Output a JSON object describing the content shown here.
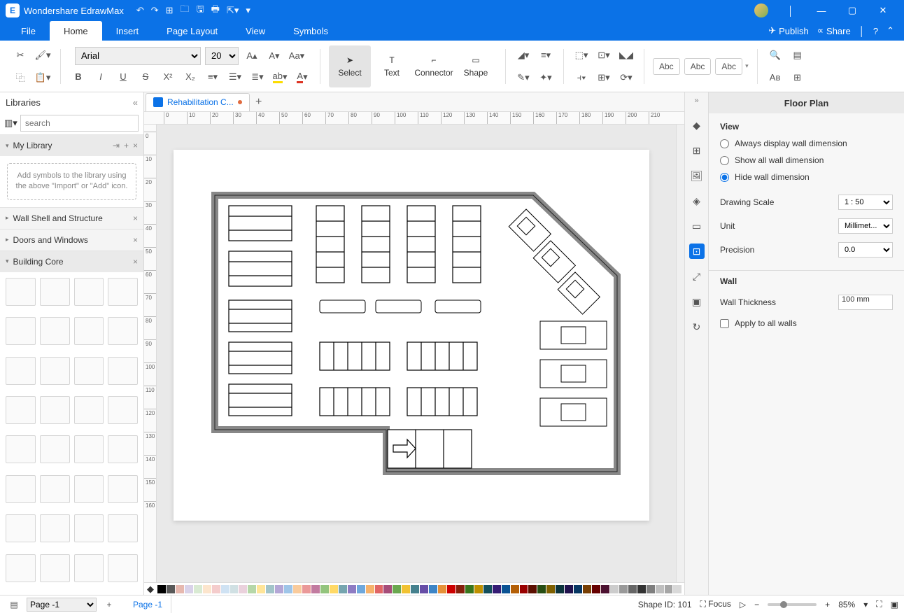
{
  "app": {
    "name": "Wondershare EdrawMax"
  },
  "menubar": {
    "tabs": [
      "File",
      "Home",
      "Insert",
      "Page Layout",
      "View",
      "Symbols"
    ],
    "active": "Home",
    "publish": "Publish",
    "share": "Share"
  },
  "ribbon": {
    "font": "Arial",
    "size": "20",
    "tools": {
      "select": "Select",
      "text": "Text",
      "connector": "Connector",
      "shape": "Shape"
    },
    "abc": "Abc"
  },
  "libraries": {
    "title": "Libraries",
    "search_ph": "search",
    "mylib": "My Library",
    "addmsg": "Add symbols to the library using the above \"Import\" or \"Add\" icon.",
    "sections": [
      "Wall Shell and Structure",
      "Doors and Windows",
      "Building Core"
    ]
  },
  "doc": {
    "tab": "Rehabilitation C..."
  },
  "ruler_h": [
    "0",
    "10",
    "20",
    "30",
    "40",
    "50",
    "60",
    "70",
    "80",
    "90",
    "100",
    "110",
    "120",
    "130",
    "140",
    "150",
    "160",
    "170",
    "180",
    "190",
    "200",
    "210"
  ],
  "ruler_v": [
    "0",
    "10",
    "20",
    "30",
    "40",
    "50",
    "60",
    "70",
    "80",
    "90",
    "100",
    "110",
    "120",
    "130",
    "140",
    "150",
    "160"
  ],
  "rightpanel": {
    "title": "Floor Plan",
    "view": "View",
    "radios": [
      "Always display wall dimension",
      "Show all wall dimension",
      "Hide wall dimension"
    ],
    "selected": 2,
    "scale_label": "Drawing Scale",
    "scale": "1 : 50",
    "unit_label": "Unit",
    "unit": "Millimet...",
    "precision_label": "Precision",
    "precision": "0.0",
    "wall": "Wall",
    "thickness_label": "Wall Thickness",
    "thickness": "100 mm",
    "apply": "Apply to all walls"
  },
  "status": {
    "page": "Page -1",
    "pagetab": "Page -1",
    "shapeid": "Shape ID: 101",
    "focus": "Focus",
    "zoom": "85%"
  },
  "palette_colors": [
    "#000000",
    "#595959",
    "#e6b8af",
    "#d9d2e9",
    "#d9ead3",
    "#fce5cd",
    "#f4cccc",
    "#cfe2f3",
    "#d0e0e3",
    "#ead1dc",
    "#b6d7a8",
    "#ffe599",
    "#a2c4c9",
    "#b4a7d6",
    "#9fc5e8",
    "#f9cb9c",
    "#ea9999",
    "#c27ba0",
    "#93c47d",
    "#ffd966",
    "#76a5af",
    "#8e7cc3",
    "#6fa8dc",
    "#f6b26b",
    "#e06666",
    "#a64d79",
    "#6aa84f",
    "#f1c232",
    "#45818e",
    "#674ea7",
    "#3d85c6",
    "#e69138",
    "#cc0000",
    "#85200c",
    "#38761d",
    "#bf9000",
    "#134f5c",
    "#351c75",
    "#0b5394",
    "#b45f06",
    "#990000",
    "#5b0f00",
    "#274e13",
    "#7f6000",
    "#0c343d",
    "#20124d",
    "#073763",
    "#783f04",
    "#660000",
    "#4c1130",
    "#cccccc",
    "#999999",
    "#666666",
    "#333333",
    "#7f7f7f",
    "#bfbfbf",
    "#a6a6a6",
    "#d9d9d9"
  ]
}
